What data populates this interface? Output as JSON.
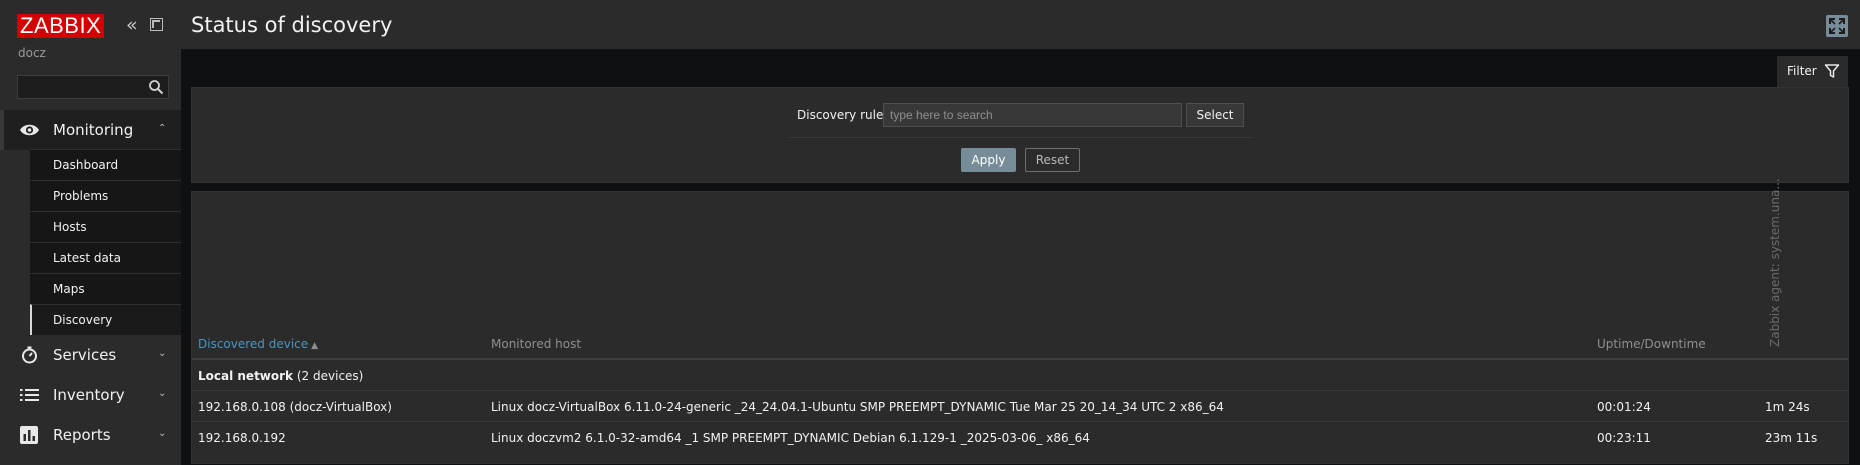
{
  "sidebar": {
    "logo": "ZABBIX",
    "server_name": "docz",
    "search_placeholder": "",
    "sections": {
      "monitoring": "Monitoring",
      "services": "Services",
      "inventory": "Inventory",
      "reports": "Reports"
    },
    "monitoring_items": [
      "Dashboard",
      "Problems",
      "Hosts",
      "Latest data",
      "Maps",
      "Discovery"
    ],
    "active_item": "Discovery"
  },
  "header": {
    "title": "Status of discovery"
  },
  "filter": {
    "tab_label": "Filter",
    "discovery_rule_label": "Discovery rule",
    "discovery_rule_placeholder": "type here to search",
    "select_label": "Select",
    "apply_label": "Apply",
    "reset_label": "Reset"
  },
  "table": {
    "headers": {
      "device": "Discovered device",
      "sort_indicator": "▲",
      "host": "Monitored host",
      "uptime": "Uptime/Downtime",
      "check": "Zabbix agent: system.una..."
    },
    "group": {
      "name": "Local network",
      "count": "(2 devices)"
    },
    "rows": [
      {
        "device": "192.168.0.108 (docz-VirtualBox)",
        "host": "Linux docz-VirtualBox 6.11.0-24-generic _24_24.04.1-Ubuntu SMP PREEMPT_DYNAMIC Tue Mar 25 20_14_34 UTC 2 x86_64",
        "uptime": "00:01:24",
        "agent": "1m 24s"
      },
      {
        "device": "192.168.0.192",
        "host": "Linux doczvm2 6.1.0-32-amd64 _1 SMP PREEMPT_DYNAMIC Debian 6.1.129-1 _2025-03-06_ x86_64",
        "uptime": "00:23:11",
        "agent": "23m 11s"
      }
    ]
  },
  "colors": {
    "brand": "#d40000",
    "accent": "#768d99",
    "link": "#4796c4"
  }
}
